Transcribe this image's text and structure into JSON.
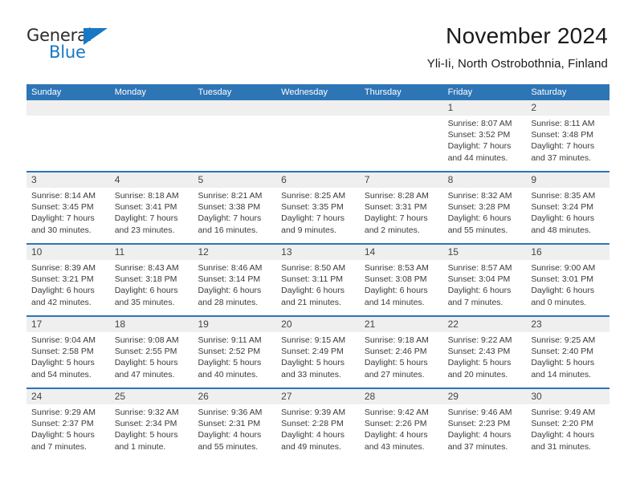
{
  "brand": {
    "name_top": "General",
    "name_bottom": "Blue",
    "triangle_color": "#1878c4"
  },
  "header": {
    "title": "November 2024",
    "subtitle": "Yli-Ii, North Ostrobothnia, Finland"
  },
  "colors": {
    "header_blue": "#2e75b6",
    "daynum_band": "#efefef",
    "text": "#3a3a3a"
  },
  "calendar": {
    "weekday_headers": [
      "Sunday",
      "Monday",
      "Tuesday",
      "Wednesday",
      "Thursday",
      "Friday",
      "Saturday"
    ],
    "weeks": [
      [
        {
          "day": "",
          "sunrise": "",
          "sunset": "",
          "daylight_line1": "",
          "daylight_line2": "",
          "empty": true
        },
        {
          "day": "",
          "sunrise": "",
          "sunset": "",
          "daylight_line1": "",
          "daylight_line2": "",
          "empty": true
        },
        {
          "day": "",
          "sunrise": "",
          "sunset": "",
          "daylight_line1": "",
          "daylight_line2": "",
          "empty": true
        },
        {
          "day": "",
          "sunrise": "",
          "sunset": "",
          "daylight_line1": "",
          "daylight_line2": "",
          "empty": true
        },
        {
          "day": "",
          "sunrise": "",
          "sunset": "",
          "daylight_line1": "",
          "daylight_line2": "",
          "empty": true
        },
        {
          "day": "1",
          "sunrise": "Sunrise: 8:07 AM",
          "sunset": "Sunset: 3:52 PM",
          "daylight_line1": "Daylight: 7 hours",
          "daylight_line2": "and 44 minutes."
        },
        {
          "day": "2",
          "sunrise": "Sunrise: 8:11 AM",
          "sunset": "Sunset: 3:48 PM",
          "daylight_line1": "Daylight: 7 hours",
          "daylight_line2": "and 37 minutes."
        }
      ],
      [
        {
          "day": "3",
          "sunrise": "Sunrise: 8:14 AM",
          "sunset": "Sunset: 3:45 PM",
          "daylight_line1": "Daylight: 7 hours",
          "daylight_line2": "and 30 minutes."
        },
        {
          "day": "4",
          "sunrise": "Sunrise: 8:18 AM",
          "sunset": "Sunset: 3:41 PM",
          "daylight_line1": "Daylight: 7 hours",
          "daylight_line2": "and 23 minutes."
        },
        {
          "day": "5",
          "sunrise": "Sunrise: 8:21 AM",
          "sunset": "Sunset: 3:38 PM",
          "daylight_line1": "Daylight: 7 hours",
          "daylight_line2": "and 16 minutes."
        },
        {
          "day": "6",
          "sunrise": "Sunrise: 8:25 AM",
          "sunset": "Sunset: 3:35 PM",
          "daylight_line1": "Daylight: 7 hours",
          "daylight_line2": "and 9 minutes."
        },
        {
          "day": "7",
          "sunrise": "Sunrise: 8:28 AM",
          "sunset": "Sunset: 3:31 PM",
          "daylight_line1": "Daylight: 7 hours",
          "daylight_line2": "and 2 minutes."
        },
        {
          "day": "8",
          "sunrise": "Sunrise: 8:32 AM",
          "sunset": "Sunset: 3:28 PM",
          "daylight_line1": "Daylight: 6 hours",
          "daylight_line2": "and 55 minutes."
        },
        {
          "day": "9",
          "sunrise": "Sunrise: 8:35 AM",
          "sunset": "Sunset: 3:24 PM",
          "daylight_line1": "Daylight: 6 hours",
          "daylight_line2": "and 48 minutes."
        }
      ],
      [
        {
          "day": "10",
          "sunrise": "Sunrise: 8:39 AM",
          "sunset": "Sunset: 3:21 PM",
          "daylight_line1": "Daylight: 6 hours",
          "daylight_line2": "and 42 minutes."
        },
        {
          "day": "11",
          "sunrise": "Sunrise: 8:43 AM",
          "sunset": "Sunset: 3:18 PM",
          "daylight_line1": "Daylight: 6 hours",
          "daylight_line2": "and 35 minutes."
        },
        {
          "day": "12",
          "sunrise": "Sunrise: 8:46 AM",
          "sunset": "Sunset: 3:14 PM",
          "daylight_line1": "Daylight: 6 hours",
          "daylight_line2": "and 28 minutes."
        },
        {
          "day": "13",
          "sunrise": "Sunrise: 8:50 AM",
          "sunset": "Sunset: 3:11 PM",
          "daylight_line1": "Daylight: 6 hours",
          "daylight_line2": "and 21 minutes."
        },
        {
          "day": "14",
          "sunrise": "Sunrise: 8:53 AM",
          "sunset": "Sunset: 3:08 PM",
          "daylight_line1": "Daylight: 6 hours",
          "daylight_line2": "and 14 minutes."
        },
        {
          "day": "15",
          "sunrise": "Sunrise: 8:57 AM",
          "sunset": "Sunset: 3:04 PM",
          "daylight_line1": "Daylight: 6 hours",
          "daylight_line2": "and 7 minutes."
        },
        {
          "day": "16",
          "sunrise": "Sunrise: 9:00 AM",
          "sunset": "Sunset: 3:01 PM",
          "daylight_line1": "Daylight: 6 hours",
          "daylight_line2": "and 0 minutes."
        }
      ],
      [
        {
          "day": "17",
          "sunrise": "Sunrise: 9:04 AM",
          "sunset": "Sunset: 2:58 PM",
          "daylight_line1": "Daylight: 5 hours",
          "daylight_line2": "and 54 minutes."
        },
        {
          "day": "18",
          "sunrise": "Sunrise: 9:08 AM",
          "sunset": "Sunset: 2:55 PM",
          "daylight_line1": "Daylight: 5 hours",
          "daylight_line2": "and 47 minutes."
        },
        {
          "day": "19",
          "sunrise": "Sunrise: 9:11 AM",
          "sunset": "Sunset: 2:52 PM",
          "daylight_line1": "Daylight: 5 hours",
          "daylight_line2": "and 40 minutes."
        },
        {
          "day": "20",
          "sunrise": "Sunrise: 9:15 AM",
          "sunset": "Sunset: 2:49 PM",
          "daylight_line1": "Daylight: 5 hours",
          "daylight_line2": "and 33 minutes."
        },
        {
          "day": "21",
          "sunrise": "Sunrise: 9:18 AM",
          "sunset": "Sunset: 2:46 PM",
          "daylight_line1": "Daylight: 5 hours",
          "daylight_line2": "and 27 minutes."
        },
        {
          "day": "22",
          "sunrise": "Sunrise: 9:22 AM",
          "sunset": "Sunset: 2:43 PM",
          "daylight_line1": "Daylight: 5 hours",
          "daylight_line2": "and 20 minutes."
        },
        {
          "day": "23",
          "sunrise": "Sunrise: 9:25 AM",
          "sunset": "Sunset: 2:40 PM",
          "daylight_line1": "Daylight: 5 hours",
          "daylight_line2": "and 14 minutes."
        }
      ],
      [
        {
          "day": "24",
          "sunrise": "Sunrise: 9:29 AM",
          "sunset": "Sunset: 2:37 PM",
          "daylight_line1": "Daylight: 5 hours",
          "daylight_line2": "and 7 minutes."
        },
        {
          "day": "25",
          "sunrise": "Sunrise: 9:32 AM",
          "sunset": "Sunset: 2:34 PM",
          "daylight_line1": "Daylight: 5 hours",
          "daylight_line2": "and 1 minute."
        },
        {
          "day": "26",
          "sunrise": "Sunrise: 9:36 AM",
          "sunset": "Sunset: 2:31 PM",
          "daylight_line1": "Daylight: 4 hours",
          "daylight_line2": "and 55 minutes."
        },
        {
          "day": "27",
          "sunrise": "Sunrise: 9:39 AM",
          "sunset": "Sunset: 2:28 PM",
          "daylight_line1": "Daylight: 4 hours",
          "daylight_line2": "and 49 minutes."
        },
        {
          "day": "28",
          "sunrise": "Sunrise: 9:42 AM",
          "sunset": "Sunset: 2:26 PM",
          "daylight_line1": "Daylight: 4 hours",
          "daylight_line2": "and 43 minutes."
        },
        {
          "day": "29",
          "sunrise": "Sunrise: 9:46 AM",
          "sunset": "Sunset: 2:23 PM",
          "daylight_line1": "Daylight: 4 hours",
          "daylight_line2": "and 37 minutes."
        },
        {
          "day": "30",
          "sunrise": "Sunrise: 9:49 AM",
          "sunset": "Sunset: 2:20 PM",
          "daylight_line1": "Daylight: 4 hours",
          "daylight_line2": "and 31 minutes."
        }
      ]
    ]
  }
}
